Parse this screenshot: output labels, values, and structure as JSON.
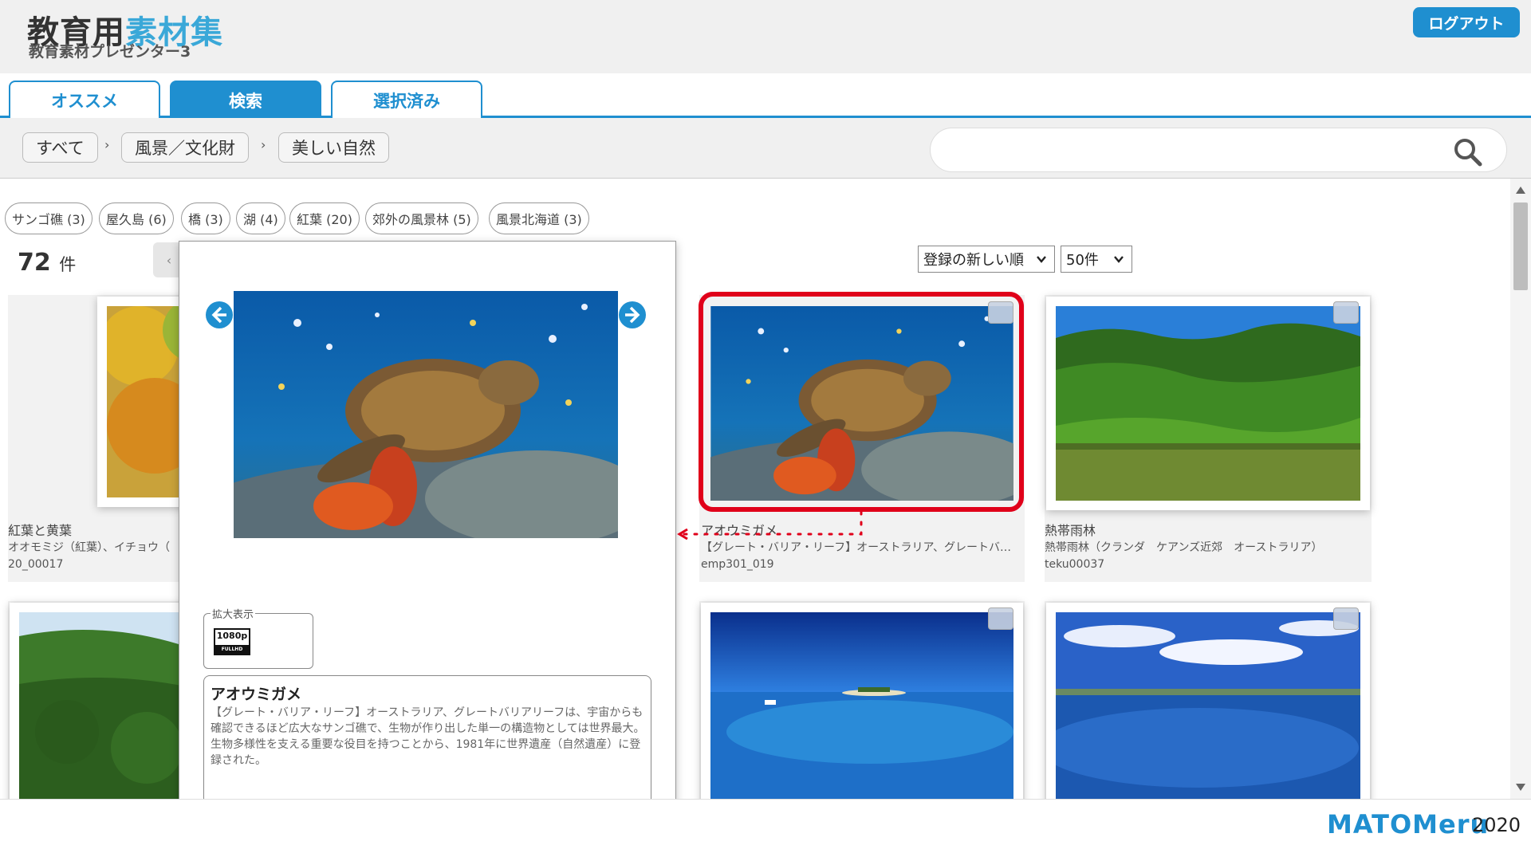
{
  "app": {
    "logo_left": "教育用",
    "logo_accent": "素材集",
    "subtitle": "教育素材プレゼンター3",
    "logout_label": "ログアウト"
  },
  "tabs": [
    {
      "label": "オススメ",
      "active": false
    },
    {
      "label": "検索",
      "active": true
    },
    {
      "label": "選択済み",
      "active": false
    }
  ],
  "breadcrumb": [
    "すべて",
    "風景／文化財",
    "美しい自然"
  ],
  "search": {
    "value": "",
    "placeholder": ""
  },
  "tags": [
    "サンゴ礁 (3)",
    "屋久島 (6)",
    "橋 (3)",
    "湖 (4)",
    "紅葉 (20)",
    "郊外の風景林 (5)",
    "風景北海道 (3)"
  ],
  "result": {
    "count": "72",
    "unit": "件"
  },
  "sort": {
    "order": "登録の新しい順",
    "per_page": "50件"
  },
  "cards": [
    {
      "title": "紅葉と黄葉",
      "desc": "オオモミジ（紅葉）、イチョウ（",
      "id": "20_00017"
    },
    {
      "title": "アオウミガメ",
      "desc": "【グレート・バリア・リーフ】オーストラリア、グレートバ…",
      "id": "emp301_019"
    },
    {
      "title": "熱帯雨林",
      "desc": "熱帯雨林（クランダ　ケアンズ近郊　オーストラリア）",
      "id": "teku00037"
    }
  ],
  "preview": {
    "zoom_label": "拡大表示",
    "badge_res": "1080p",
    "badge_sub": "FULLHD",
    "title": "アオウミガメ",
    "description": "【グレート・バリア・リーフ】オーストラリア、グレートバリアリーフは、宇宙からも確認できるほど広大なサンゴ礁で、生物が作り出した単一の構造物としては世界最大。生物多様性を支える重要な役目を持つことから、1981年に世界遺産（自然遺産）に登録された。"
  },
  "footer": {
    "brand": "MATOMeru",
    "year": "2020"
  },
  "colors": {
    "accent": "#1f8fd0",
    "logo_accent": "#3aa8d8",
    "highlight": "#e0001a"
  }
}
